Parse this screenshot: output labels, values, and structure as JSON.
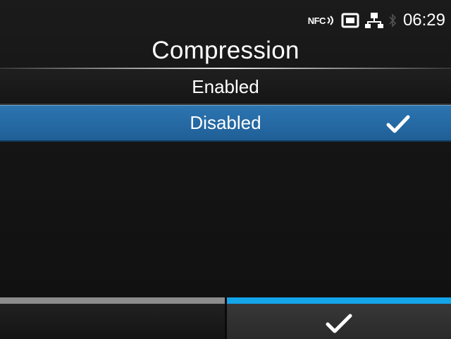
{
  "status": {
    "nfc_label": "NFC",
    "time": "06:29"
  },
  "header": {
    "title": "Compression"
  },
  "options": [
    {
      "label": "Enabled",
      "selected": false
    },
    {
      "label": "Disabled",
      "selected": true
    }
  ],
  "softkeys": {
    "left": {
      "label": "",
      "accent": "#8c8c8c"
    },
    "right": {
      "icon": "checkmark-icon",
      "accent": "#13a4ea"
    }
  },
  "colors": {
    "selection": "#2c75b1",
    "accent": "#13a4ea"
  },
  "icons": [
    "nfc-icon",
    "sd-card-icon",
    "network-icon",
    "bluetooth-icon",
    "checkmark-icon"
  ]
}
